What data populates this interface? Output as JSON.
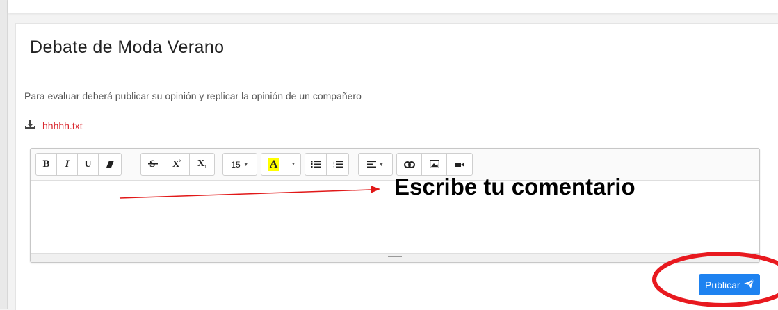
{
  "header": {
    "title": "Debate de Moda Verano"
  },
  "content": {
    "instructions": "Para evaluar deberá publicar su opinión y replicar la opinión de un compañero",
    "attachment": {
      "icon": "download-icon",
      "filename": "hhhhh.txt"
    }
  },
  "editor": {
    "toolbar": {
      "bold": "B",
      "italic": "I",
      "underline": "U",
      "font_size": "15",
      "highlight_letter": "A",
      "highlight_color": "#ffff00"
    }
  },
  "annotation": {
    "label": "Escribe tu comentario",
    "arrow_color": "#e11818",
    "circle_color": "#e8191f"
  },
  "actions": {
    "publish_label": "Publicar",
    "publish_icon": "paper-plane-icon",
    "publish_color": "#1e82f0"
  }
}
